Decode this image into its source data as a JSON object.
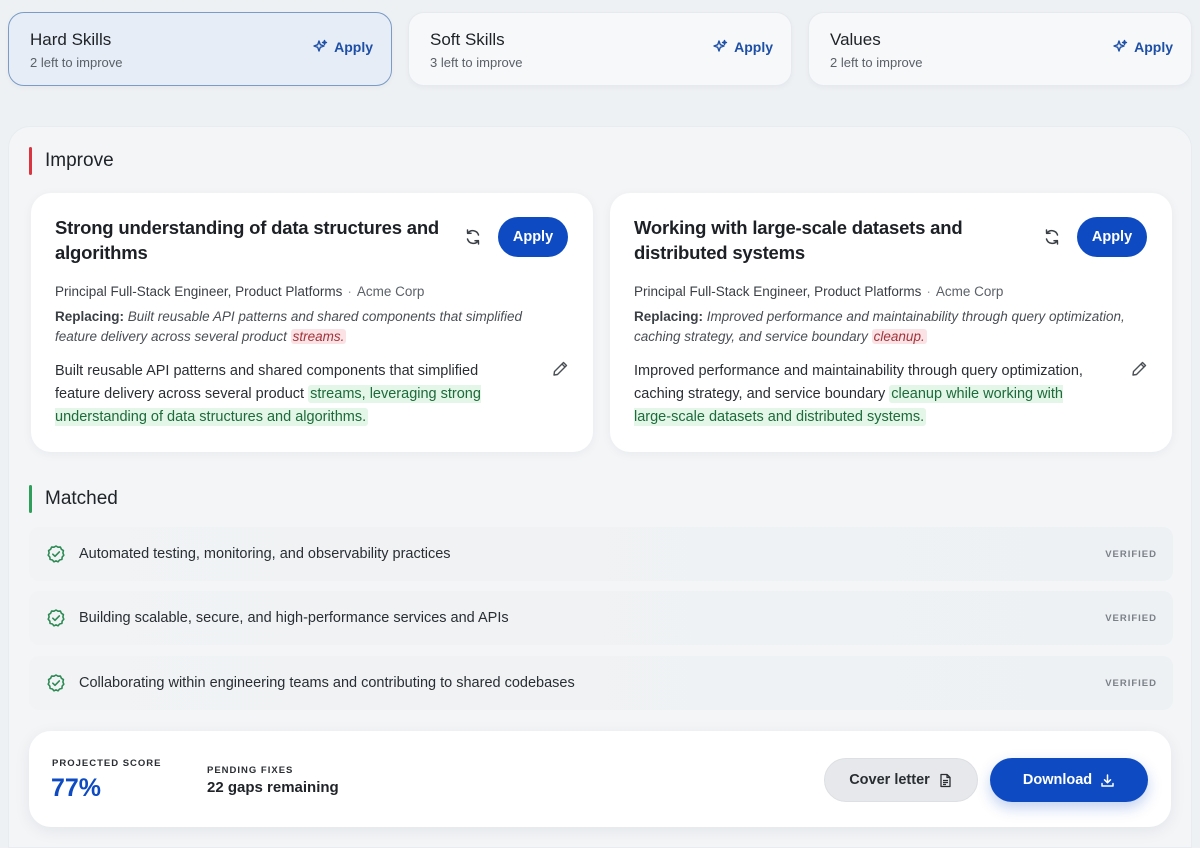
{
  "tabs": [
    {
      "title": "Hard Skills",
      "subtitle": "2 left to improve",
      "apply_label": "Apply",
      "icon": "sparkle-icon",
      "active": true
    },
    {
      "title": "Soft Skills",
      "subtitle": "3 left to improve",
      "apply_label": "Apply",
      "icon": "sparkle-icon",
      "active": false
    },
    {
      "title": "Values",
      "subtitle": "2 left to improve",
      "apply_label": "Apply",
      "icon": "sparkle-icon",
      "active": false
    }
  ],
  "improve": {
    "title": "Improve",
    "accent_color": "#d9343f",
    "cards": [
      {
        "title": "Strong understanding of data structures and algorithms",
        "apply_label": "Apply",
        "role": "Principal Full-Stack Engineer, Product Platforms",
        "separator": "·",
        "company": "Acme Corp",
        "replacing_label": "Replacing:",
        "replacing_text": "Built reusable API patterns and shared components that simplified feature delivery across several product",
        "replacing_highlight": "streams.",
        "new_text": "Built reusable API patterns and shared components that simplified feature delivery across several product",
        "new_highlight": "streams, leveraging strong understanding of data structures and algorithms."
      },
      {
        "title": "Working with large-scale datasets and distributed systems",
        "apply_label": "Apply",
        "role": "Principal Full-Stack Engineer, Product Platforms",
        "separator": "·",
        "company": "Acme Corp",
        "replacing_label": "Replacing:",
        "replacing_text": "Improved performance and maintainability through query optimization, caching strategy, and service boundary",
        "replacing_highlight": "cleanup.",
        "new_text": "Improved performance and maintainability through query optimization, caching strategy, and service boundary",
        "new_highlight": "cleanup while working with large-scale datasets and distributed systems."
      }
    ]
  },
  "matched": {
    "title": "Matched",
    "accent_color": "#2e9e5b",
    "items": [
      {
        "text": "Automated testing, monitoring, and observability practices",
        "status": "VERIFIED"
      },
      {
        "text": "Building scalable, secure, and high-performance services and APIs",
        "status": "VERIFIED"
      },
      {
        "text": "Collaborating within engineering teams and contributing to shared codebases",
        "status": "VERIFIED"
      }
    ]
  },
  "footer": {
    "projected_label": "PROJECTED SCORE",
    "projected_value": "77%",
    "pending_label": "PENDING FIXES",
    "pending_value": "22 gaps remaining",
    "cover_letter_label": "Cover letter",
    "download_label": "Download"
  },
  "colors": {
    "primary": "#0e4bc2",
    "highlight_green_bg": "#e3f6e8",
    "highlight_red_bg": "#fbe3e5"
  }
}
